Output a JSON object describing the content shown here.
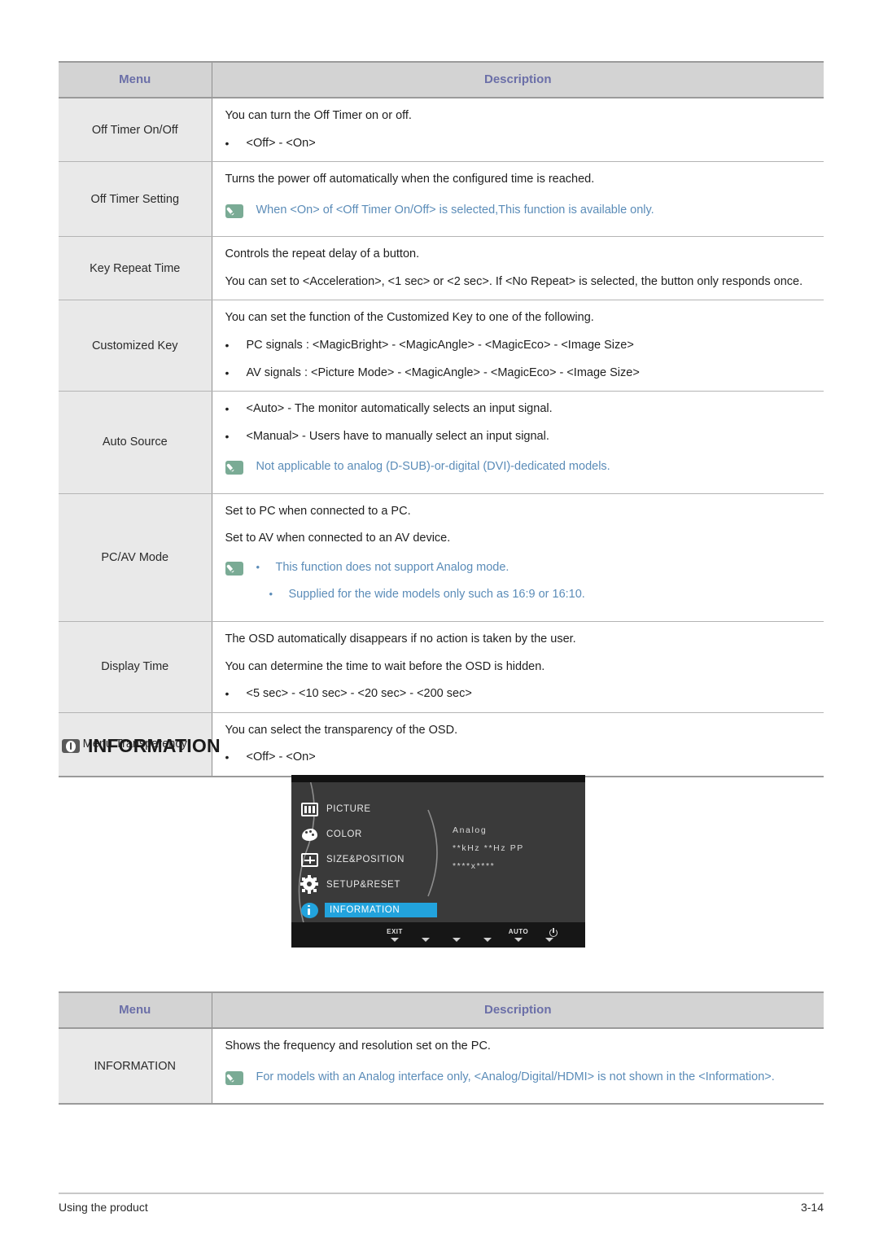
{
  "tables": {
    "setup_reset": {
      "headers": {
        "menu": "Menu",
        "description": "Description"
      },
      "rows": [
        {
          "menu": "Off Timer On/Off",
          "lines": [
            "You can turn the Off Timer on or off."
          ],
          "bullets": [
            "<Off> - <On>"
          ]
        },
        {
          "menu": "Off Timer Setting",
          "lines": [
            "Turns the power off automatically when the configured time is reached."
          ],
          "note": "When <On> of <Off Timer On/Off> is selected,This function is available only."
        },
        {
          "menu": "Key Repeat Time",
          "lines": [
            "Controls the repeat delay of a button.",
            "You can set to <Acceleration>, <1 sec> or <2 sec>. If <No Repeat> is selected, the button only responds once."
          ]
        },
        {
          "menu": "Customized Key",
          "lines": [
            "You can set the function of the Customized Key to one of the following."
          ],
          "bullets": [
            "PC signals : <MagicBright> - <MagicAngle> - <MagicEco> - <Image Size>",
            "AV signals : <Picture Mode> - <MagicAngle> - <MagicEco> - <Image Size>"
          ]
        },
        {
          "menu": "Auto Source",
          "bullets": [
            "<Auto> - The monitor automatically selects an input signal.",
            "<Manual> - Users have to manually select an input signal."
          ],
          "note": "Not applicable to analog (D-SUB)-or-digital (DVI)-dedicated models."
        },
        {
          "menu": "PC/AV Mode",
          "lines": [
            "Set to PC when connected to a PC.",
            "Set to AV when connected to an AV device."
          ],
          "note_bullets": [
            "This function does not support Analog mode.",
            "Supplied for the wide models only such as 16:9 or 16:10."
          ]
        },
        {
          "menu": "Display Time",
          "lines": [
            "The OSD automatically disappears if no action is taken by the user.",
            "You can determine the time to wait before the OSD is hidden."
          ],
          "bullets": [
            "<5 sec> - <10 sec> - <20 sec> - <200 sec>"
          ]
        },
        {
          "menu": "Menu Transparency",
          "lines": [
            "You can select the transparency of the OSD."
          ],
          "bullets": [
            "<Off> - <On>"
          ]
        }
      ]
    },
    "information": {
      "headers": {
        "menu": "Menu",
        "description": "Description"
      },
      "row": {
        "menu": "INFORMATION",
        "lines": [
          "Shows the frequency and resolution set on the PC."
        ],
        "note": "For models with an Analog interface only, <Analog/Digital/HDMI> is not shown in the <Information>."
      }
    }
  },
  "section": {
    "heading": "INFORMATION",
    "heading_icon": "information-badge-icon"
  },
  "osd": {
    "menu_items": [
      {
        "label": "PICTURE",
        "icon": "picture-icon",
        "selected": false
      },
      {
        "label": "COLOR",
        "icon": "color-palette-icon",
        "selected": false
      },
      {
        "label": "SIZE&POSITION",
        "icon": "size-position-icon",
        "selected": false
      },
      {
        "label": "SETUP&RESET",
        "icon": "gear-icon",
        "selected": false
      },
      {
        "label": "INFORMATION",
        "icon": "info-circle-icon",
        "selected": true
      }
    ],
    "info_panel": {
      "signal": "Analog",
      "frequency": "**kHz **Hz PP",
      "resolution": "****x****"
    },
    "buttons": [
      {
        "caption": "EXIT",
        "icon": "exit-label"
      },
      {
        "caption": "",
        "icon": "down-arrow-icon"
      },
      {
        "caption": "",
        "icon": "up-arrow-icon"
      },
      {
        "caption": "",
        "icon": "enter-play-icon"
      },
      {
        "caption": "AUTO",
        "icon": "auto-label"
      },
      {
        "caption": "",
        "icon": "power-icon"
      }
    ],
    "highlight_color": "#22a3dd",
    "background_color": "#3a3a3a"
  },
  "footer": {
    "left": "Using the product",
    "right": "3-14"
  },
  "colors": {
    "header_bg": "#d3d3d3",
    "header_text": "#6b6fa8",
    "menu_cell_bg": "#e9e9e9",
    "note_text": "#5b8cb8",
    "note_icon_bg": "#7aab95"
  }
}
